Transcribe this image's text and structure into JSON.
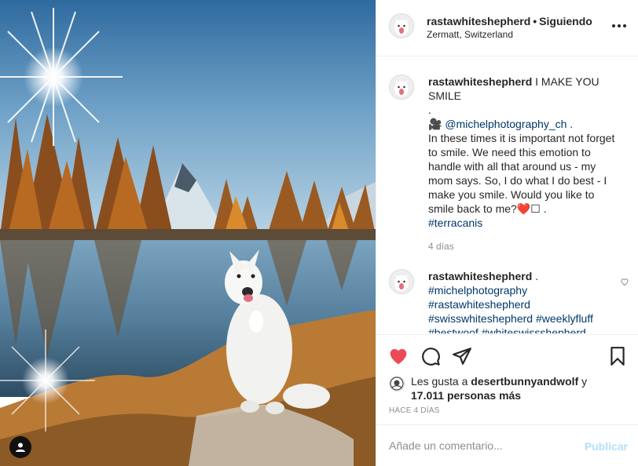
{
  "photo": {
    "alt": "White shepherd dog sitting by a mountain lake",
    "tag_icon": "user-tag-icon"
  },
  "header": {
    "username": "rastawhiteshepherd",
    "separator": "•",
    "follow_status": "Siguiendo",
    "location": "Zermatt, Switzerland",
    "more_icon": "more-options-icon"
  },
  "caption": {
    "username": "rastawhiteshepherd",
    "title": "I MAKE YOU SMILE",
    "dot_line": ".",
    "camera_emoji": "🎥",
    "mention": "@michelphotography_ch",
    "mention_suffix": " .",
    "body": "In these times it is important not forget to smile. We need this emotion to handle with all that around us - my mom says. So, I do what I do best - I make you smile. Would you like to smile back to me?",
    "emoji_tail": "❤️☐ .",
    "hashtag": "#terracanis",
    "time": "4 días"
  },
  "comment2": {
    "username": "rastawhiteshepherd",
    "suffix": " .",
    "tags": [
      "#michelphotography",
      "#rastawhiteshepherd",
      "#swisswhiteshepherd",
      "#weeklyfluff",
      "#bestwoof",
      "#whiteswissshepherd"
    ]
  },
  "actions": {
    "like_icon": "heart-filled-icon",
    "comment_icon": "comment-icon",
    "share_icon": "share-icon",
    "save_icon": "bookmark-icon"
  },
  "likes": {
    "prefix": "Les gusta a ",
    "first_user": "desertbunnyandwolf",
    "join": " y",
    "count": "17.011 personas más"
  },
  "posted_time": "HACE 4 DÍAS",
  "comment_box": {
    "placeholder": "Añade un comentario...",
    "publish_label": "Publicar"
  },
  "colors": {
    "like_red": "#ed4956",
    "link_blue": "#00376b",
    "publish_disabled": "#b2dffc"
  }
}
